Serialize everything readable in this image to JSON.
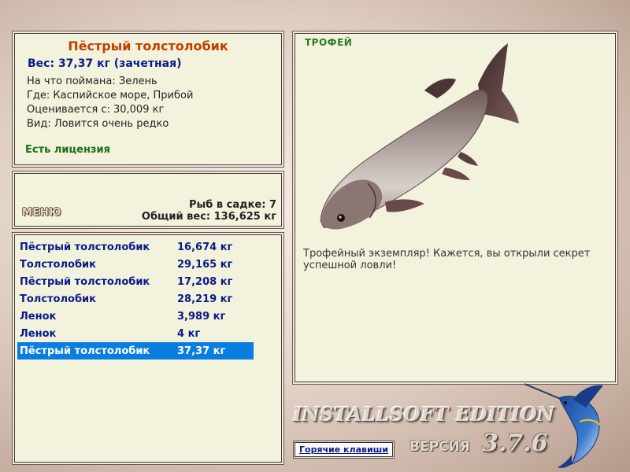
{
  "info": {
    "fish_name": "Пёстрый толстолобик",
    "weight": "Вес: 37,37 кг (зачетная)",
    "bait": "На что поймана: Зелень",
    "location": "Где: Каспийское море, Прибой",
    "rated_from": "Оценивается с: 30,009 кг",
    "kind": "Вид: Ловится очень редко",
    "license": "Есть лицензия"
  },
  "menu": {
    "button": "МЕНЮ",
    "fish_count": "Рыб в садке: 7",
    "total_weight": "Общий вес: 136,625 кг"
  },
  "catches": [
    {
      "name": "Пёстрый толстолобик",
      "weight": "16,674 кг"
    },
    {
      "name": "Толстолобик",
      "weight": "29,165 кг"
    },
    {
      "name": "Пёстрый толстолобик",
      "weight": "17,208 кг"
    },
    {
      "name": "Толстолобик",
      "weight": "28,219 кг"
    },
    {
      "name": "Ленок",
      "weight": "3,989 кг"
    },
    {
      "name": "Ленок",
      "weight": "4 кг"
    },
    {
      "name": "Пёстрый толстолобик",
      "weight": "37,37 кг",
      "selected": true
    }
  ],
  "trophy": {
    "label": "ТРОФЕЙ",
    "message": "Трофейный экземпляр! Кажется, вы открыли секрет успешной ловли!"
  },
  "footer": {
    "brand": "INSTALLSOFT EDITION",
    "version_label": "ВЕРСИЯ",
    "version": "3.7.6",
    "hotkeys": "Горячие клавиши"
  },
  "colors": {
    "selected_row": "#0a7ee0",
    "fish_name": "#c04000",
    "list_text": "#0a1a8a",
    "license": "#1c6e18"
  },
  "icons": {
    "fish_image": "bighead-carp-image",
    "logo": "marlin-logo-icon"
  }
}
